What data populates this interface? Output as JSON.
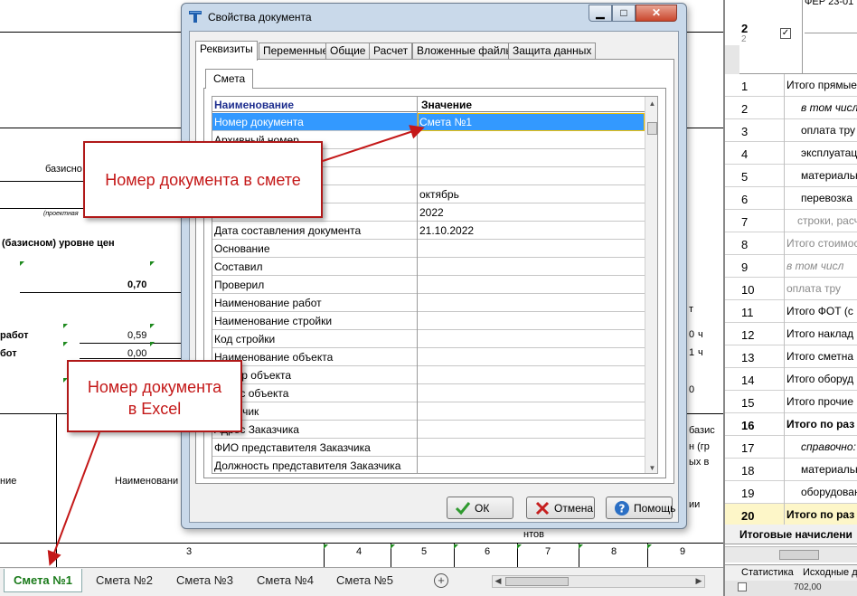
{
  "sheet": {
    "texts": {
      "bazis": "базисно",
      "proektnaya": "(проектная",
      "urovne": "(базисном) уровне цен",
      "v070": "0,70",
      "rabot": "работ",
      "bot": "бот",
      "v059": "0,59",
      "v000": "0,00",
      "nie": "ние",
      "naimenovan": "Наименовани",
      "bazi": "базис",
      "nr": "н (гр",
      "sv": "ых в",
      "t": "т",
      "ch1": "ч",
      "ch2": "ч",
      "ii": "ии",
      "ntov": "нтов",
      "col_zero": "0",
      "col_one": "1",
      "col_zero2": "0"
    },
    "column_numbers": [
      "3",
      "4",
      "5",
      "6",
      "7",
      "8",
      "9"
    ],
    "tabs": [
      "Смета №1",
      "Смета №2",
      "Смета №3",
      "Смета №4",
      "Смета №5"
    ],
    "add_tab_symbol": "+"
  },
  "right_panel": {
    "header_code": "ФЕР 23-01",
    "header_num": "2",
    "header_sub": "2",
    "rows": [
      {
        "num": "1",
        "label": "Итого прямые"
      },
      {
        "num": "2",
        "label": "в том числ"
      },
      {
        "num": "3",
        "label": "оплата тру"
      },
      {
        "num": "4",
        "label": "эксплуатац"
      },
      {
        "num": "5",
        "label": "материальн"
      },
      {
        "num": "6",
        "label": "перевозка"
      },
      {
        "num": "7",
        "label": "строки, расч"
      },
      {
        "num": "8",
        "label": "Итого стоимос"
      },
      {
        "num": "9",
        "label": "в том числ"
      },
      {
        "num": "10",
        "label": "оплата тру"
      },
      {
        "num": "11",
        "label": "Итого ФОТ (с"
      },
      {
        "num": "12",
        "label": "Итого наклад"
      },
      {
        "num": "13",
        "label": "Итого сметна"
      },
      {
        "num": "14",
        "label": "Итого оборуд"
      },
      {
        "num": "15",
        "label": "Итого прочие"
      },
      {
        "num": "16",
        "label": "Итого по раз"
      },
      {
        "num": "17",
        "label": "справочно:"
      },
      {
        "num": "18",
        "label": "материальн"
      },
      {
        "num": "19",
        "label": "оборудован"
      },
      {
        "num": "20",
        "label": "Итого по раз"
      }
    ],
    "footer_label": "Итоговые начислени",
    "tabs": [
      "Статистика",
      "Исходные д"
    ],
    "bottom_value": "702,00"
  },
  "dialog": {
    "title": "Свойства документа",
    "window_buttons": {
      "minimize": "▁",
      "maximize": "□",
      "close": "✕"
    },
    "tabs": [
      "Реквизиты",
      "Переменные",
      "Общие",
      "Расчет",
      "Вложенные файлы",
      "Защита данных"
    ],
    "inner_tab": "Смета",
    "grid": {
      "col_name": "Наименование",
      "col_value": "Значение",
      "rows": [
        {
          "name": "Номер документа",
          "value": "Смета №1",
          "selected": true
        },
        {
          "name": "Архивный номер",
          "value": ""
        },
        {
          "name": "",
          "value": ""
        },
        {
          "name": "",
          "value": ""
        },
        {
          "name": "",
          "value": "октябрь"
        },
        {
          "name": "",
          "value": "2022"
        },
        {
          "name": "Дата составления документа",
          "value": "21.10.2022"
        },
        {
          "name": "Основание",
          "value": ""
        },
        {
          "name": "Составил",
          "value": ""
        },
        {
          "name": "Проверил",
          "value": ""
        },
        {
          "name": "Наименование работ",
          "value": ""
        },
        {
          "name": "Наименование стройки",
          "value": ""
        },
        {
          "name": "Код стройки",
          "value": ""
        },
        {
          "name": "Наименование объекта",
          "value": ""
        },
        {
          "name": "Номер объекта",
          "value": ""
        },
        {
          "name": "Адрес объекта",
          "value": ""
        },
        {
          "name": "Заказчик",
          "value": ""
        },
        {
          "name": "Адрес Заказчика",
          "value": ""
        },
        {
          "name": "ФИО представителя Заказчика",
          "value": ""
        },
        {
          "name": "Должность представителя Заказчика",
          "value": ""
        }
      ]
    },
    "buttons": {
      "ok": "ОК",
      "cancel": "Отмена",
      "help": "Помощь"
    }
  },
  "callouts": {
    "doc_number_in_estimate": "Номер документа в смете",
    "doc_number_in_excel_line1": "Номер документа",
    "doc_number_in_excel_line2": "в Excel"
  },
  "colors": {
    "accent_red": "#c41818",
    "selection_blue": "#3399ff",
    "tab_green": "#1a7a1a"
  }
}
